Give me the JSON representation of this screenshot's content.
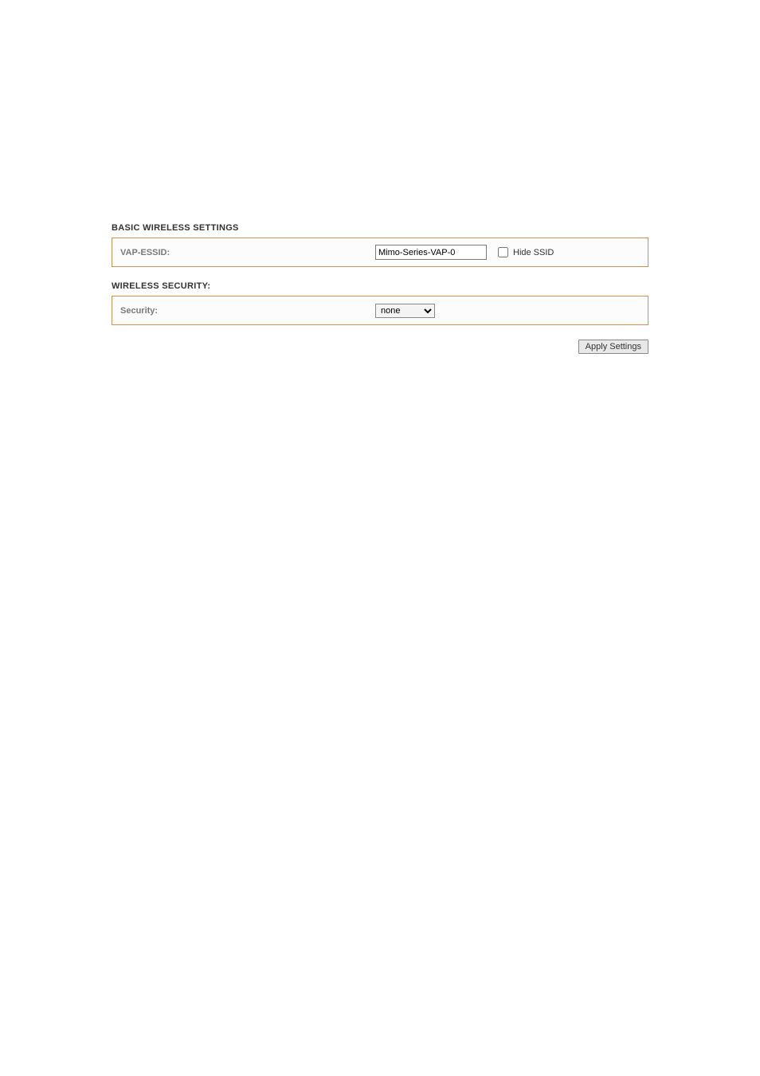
{
  "basic_settings": {
    "header": "BASIC WIRELESS SETTINGS",
    "vap_essid_label": "VAP-ESSID:",
    "vap_essid_value": "Mimo-Series-VAP-0",
    "hide_ssid_label": "Hide SSID"
  },
  "wireless_security": {
    "header": "WIRELESS SECURITY:",
    "security_label": "Security:",
    "security_value": "none"
  },
  "buttons": {
    "apply_label": "Apply Settings"
  }
}
